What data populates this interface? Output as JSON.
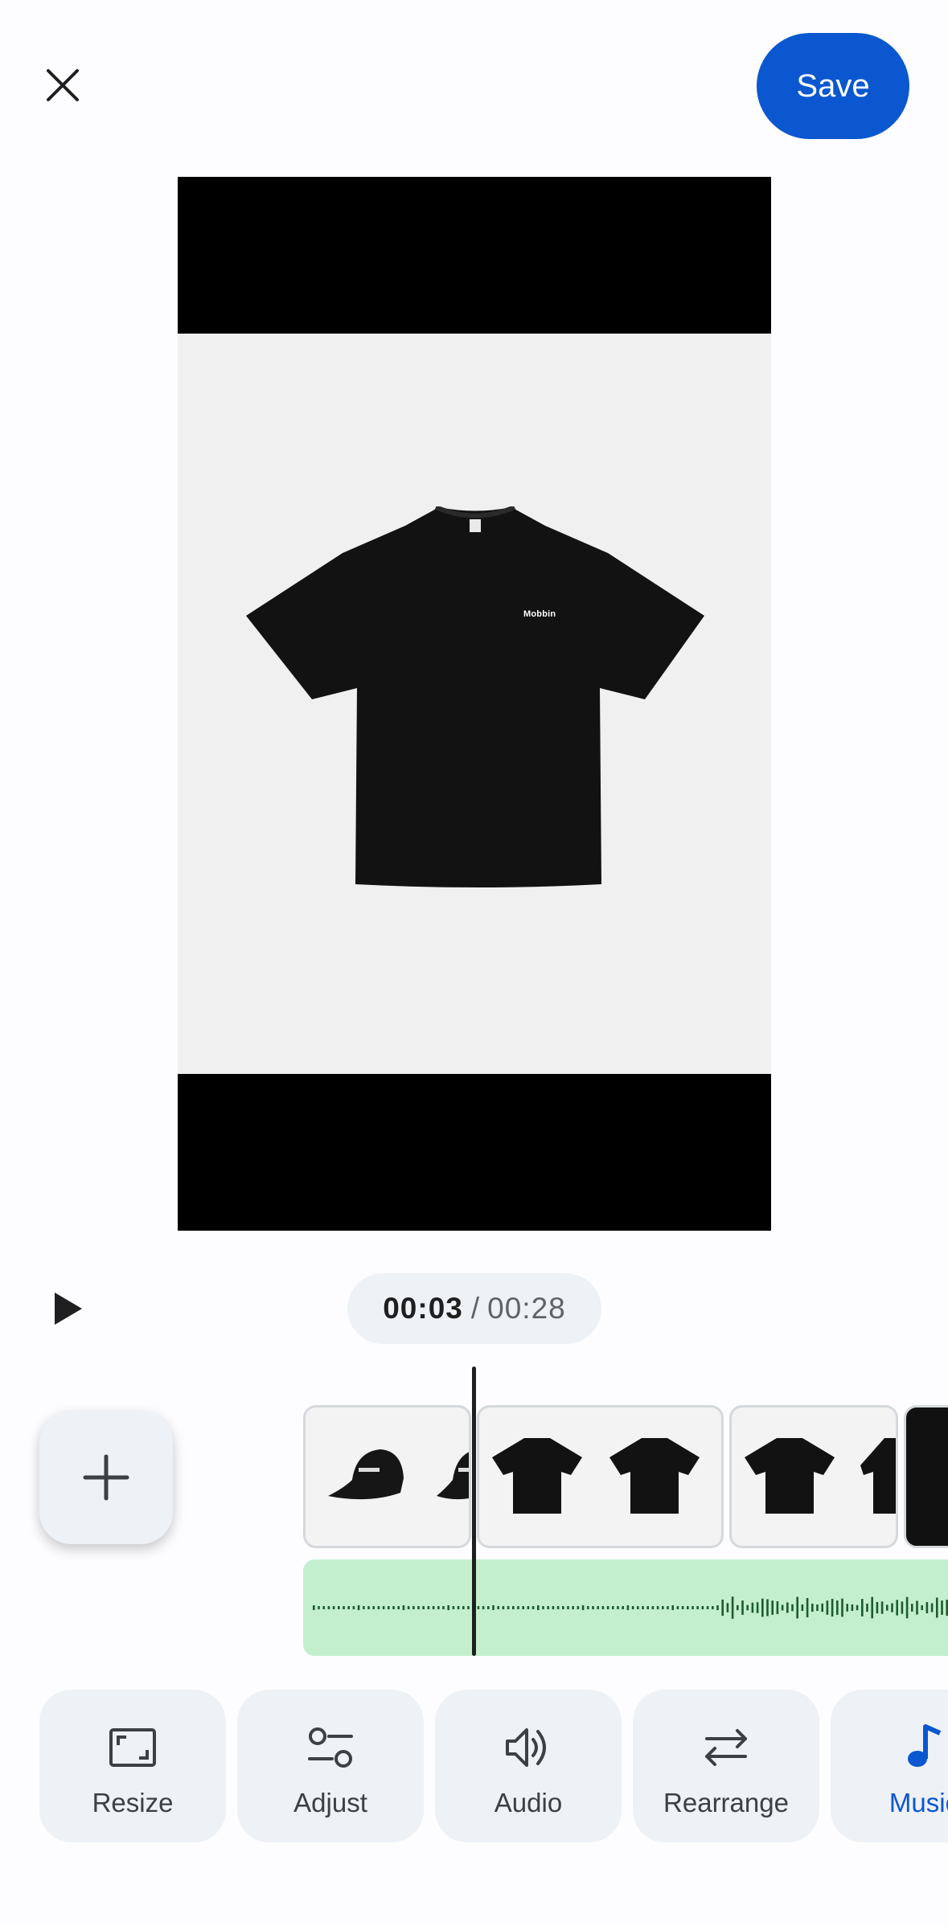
{
  "header": {
    "close_icon": "close-icon",
    "save_label": "Save"
  },
  "preview": {
    "shirt_brand": "Mobbin"
  },
  "playback": {
    "play_icon": "play-icon",
    "current_time": "00:03",
    "separator": "/",
    "total_time": "00:28"
  },
  "timeline": {
    "add_icon": "plus-icon",
    "clips": [
      "cap-clip",
      "tshirt-clip",
      "tshirt-clip",
      "tshirt-clip"
    ],
    "audio_color": "#c4efcf"
  },
  "tools": [
    {
      "label": "Resize",
      "icon": "resize-icon"
    },
    {
      "label": "Adjust",
      "icon": "adjust-icon"
    },
    {
      "label": "Audio",
      "icon": "audio-icon"
    },
    {
      "label": "Rearrange",
      "icon": "rearrange-icon"
    },
    {
      "label": "Music",
      "icon": "music-icon",
      "active": true
    }
  ],
  "colors": {
    "accent": "#0b57d0",
    "pill_bg": "#eef1f6",
    "audio_track": "#c4efcf",
    "waveform": "#1e5a2f"
  }
}
